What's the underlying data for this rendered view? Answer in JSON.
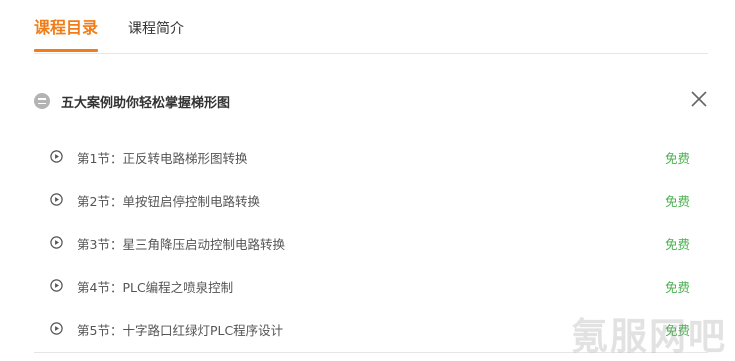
{
  "tabs": [
    {
      "label": "课程目录"
    },
    {
      "label": "课程简介"
    }
  ],
  "chapter": {
    "title": "五大案例助你轻松掌握梯形图"
  },
  "lessons": [
    {
      "title": "第1节：正反转电路梯形图转换",
      "badge": "免费"
    },
    {
      "title": "第2节：单按钮启停控制电路转换",
      "badge": "免费"
    },
    {
      "title": "第3节：星三角降压启动控制电路转换",
      "badge": "免费"
    },
    {
      "title": "第4节：PLC编程之喷泉控制",
      "badge": "免费"
    },
    {
      "title": "第5节：十字路口红绿灯PLC程序设计",
      "badge": "免费"
    }
  ],
  "watermark": "氪服网吧",
  "colors": {
    "accent": "#f07d18",
    "free": "#4cb050"
  }
}
